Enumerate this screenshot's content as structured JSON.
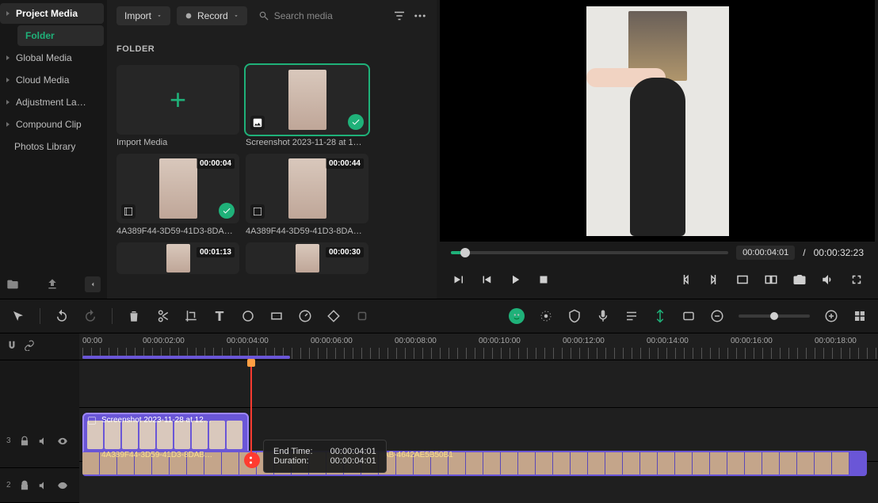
{
  "sidebar": {
    "items": [
      {
        "label": "Project Media",
        "active": true,
        "children": [
          {
            "label": "Folder",
            "selected": true
          }
        ]
      },
      {
        "label": "Global Media"
      },
      {
        "label": "Cloud Media"
      },
      {
        "label": "Adjustment La…"
      },
      {
        "label": "Compound Clip"
      },
      {
        "label": "Photos Library"
      }
    ]
  },
  "browser": {
    "import_label": "Import",
    "record_label": "Record",
    "search_placeholder": "Search media",
    "folder_label": "FOLDER",
    "import_media_label": "Import Media",
    "items": [
      {
        "name": "Screenshot 2023-11-28 at 1…",
        "checked": true,
        "selected": true,
        "type": "image"
      },
      {
        "name": "4A389F44-3D59-41D3-8DA…",
        "duration": "00:00:04",
        "checked": true,
        "type": "video"
      },
      {
        "name": "4A389F44-3D59-41D3-8DA…",
        "duration": "00:00:44",
        "type": "video"
      },
      {
        "name": "",
        "duration": "00:01:13",
        "type": "video"
      },
      {
        "name": "",
        "duration": "00:00:30",
        "type": "video"
      }
    ]
  },
  "preview": {
    "current_time": "00:00:04:01",
    "total_time": "00:00:32:23",
    "separator": "/"
  },
  "timeline": {
    "ruler": [
      "00:00",
      "00:00:02:00",
      "00:00:04:00",
      "00:00:06:00",
      "00:00:08:00",
      "00:00:10:00",
      "00:00:12:00",
      "00:00:14:00",
      "00:00:16:00",
      "00:00:18:00"
    ],
    "track_labels": [
      "3",
      "2"
    ],
    "clip1_label": "Screenshot 2023-11-28 at 12…",
    "clip2_label": "4A389F44-3D59-41D3-8DAB…",
    "clip2_label_b": "AB-4642AE5B50B1",
    "tooltip": {
      "end_time_label": "End Time:",
      "end_time": "00:00:04:01",
      "duration_label": "Duration:",
      "duration": "00:00:04:01"
    }
  }
}
